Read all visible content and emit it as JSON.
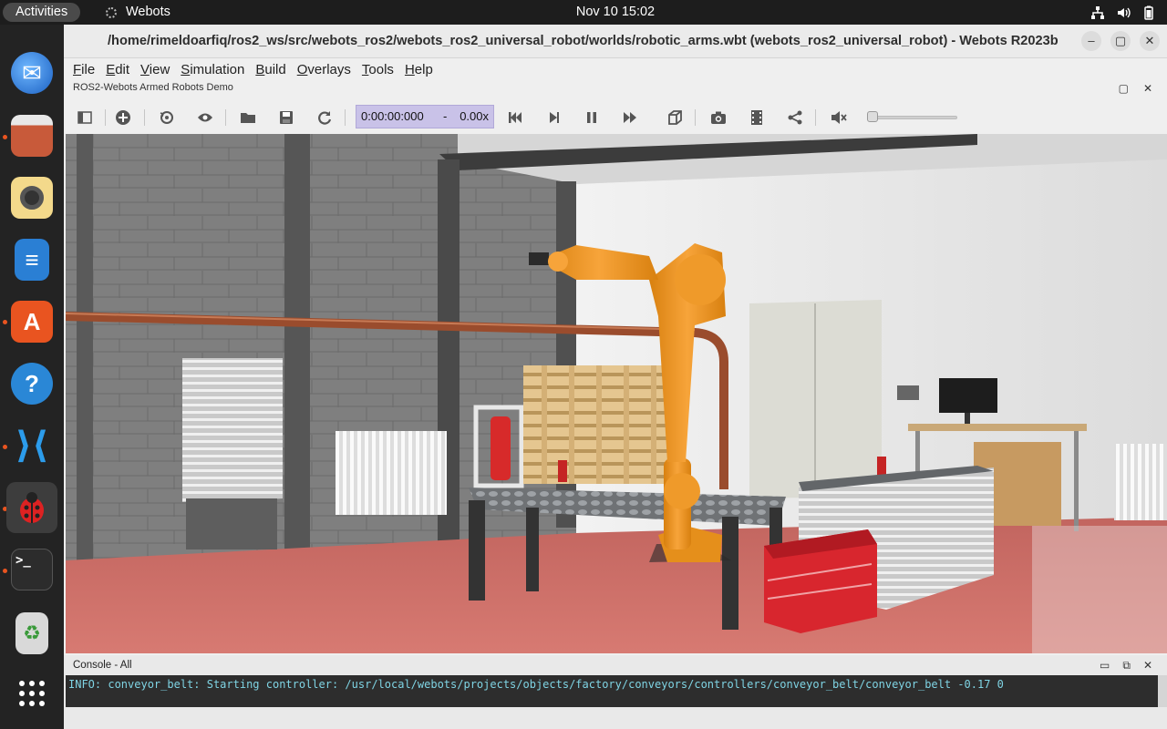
{
  "topbar": {
    "activities": "Activities",
    "app_name": "Webots",
    "clock": "Nov 10  15:02"
  },
  "dock": {
    "items": [
      {
        "name": "Thunderbird Mail",
        "icon": "thunderbird-icon"
      },
      {
        "name": "Files",
        "icon": "files-icon"
      },
      {
        "name": "Rhythmbox",
        "icon": "rhythmbox-icon"
      },
      {
        "name": "LibreOffice Writer",
        "icon": "writer-icon"
      },
      {
        "name": "Ubuntu Software",
        "icon": "software-icon"
      },
      {
        "name": "Help",
        "icon": "help-icon"
      },
      {
        "name": "Visual Studio Code",
        "icon": "vscode-icon"
      },
      {
        "name": "Webots",
        "icon": "webots-ladybug-icon"
      },
      {
        "name": "Terminal",
        "icon": "terminal-icon"
      },
      {
        "name": "Trash",
        "icon": "trash-icon"
      },
      {
        "name": "Show Applications",
        "icon": "app-grid-icon"
      }
    ]
  },
  "window": {
    "title": "/home/rimeldoarfiq/ros2_ws/src/webots_ros2/webots_ros2_universal_robot/worlds/robotic_arms.wbt (webots_ros2_universal_robot) - Webots R2023b",
    "minimize": "–",
    "maximize": "▢",
    "close": "✕"
  },
  "menu": [
    {
      "label": "File",
      "key": "F",
      "rest": "ile"
    },
    {
      "label": "Edit",
      "key": "E",
      "rest": "dit"
    },
    {
      "label": "View",
      "key": "V",
      "rest": "iew"
    },
    {
      "label": "Simulation",
      "key": "S",
      "rest": "imulation"
    },
    {
      "label": "Build",
      "key": "B",
      "rest": "uild"
    },
    {
      "label": "Overlays",
      "key": "O",
      "rest": "verlays"
    },
    {
      "label": "Tools",
      "key": "T",
      "rest": "ools"
    },
    {
      "label": "Help",
      "key": "H",
      "rest": "elp"
    }
  ],
  "viewer": {
    "subtitle": "ROS2-Webots Armed Robots Demo",
    "sim_time": "0:00:00:000",
    "separator": "-",
    "speed": "0.00x",
    "volume_level": 0
  },
  "console": {
    "title": "Console - All",
    "line": "INFO: conveyor_belt: Starting controller: /usr/local/webots/projects/objects/factory/conveyors/controllers/conveyor_belt/conveyor_belt -0.17 0"
  },
  "colors": {
    "robot": "#f39a1c",
    "floor": "#cf6a63",
    "crate": "#d8262e",
    "console_text": "#7fd4e4",
    "time_box": "#c9c2e8"
  }
}
